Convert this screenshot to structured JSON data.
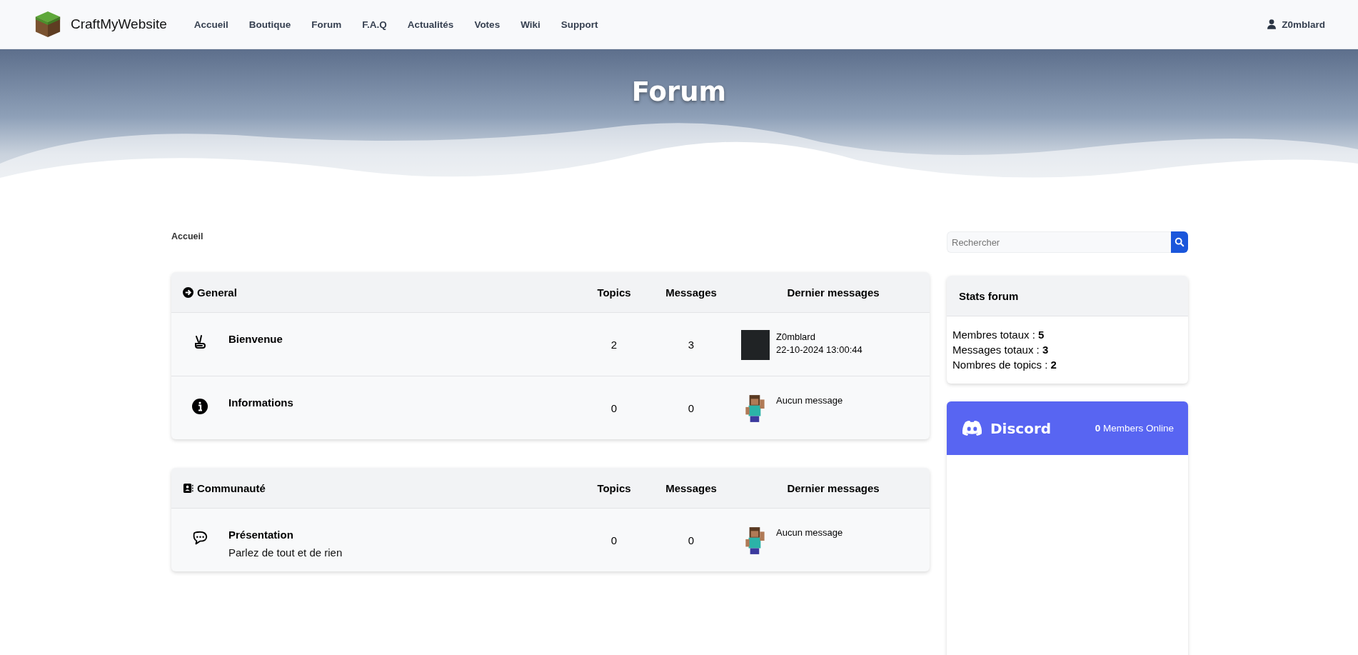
{
  "navbar": {
    "brand": "CraftMyWebsite",
    "links": [
      {
        "label": "Accueil"
      },
      {
        "label": "Boutique"
      },
      {
        "label": "Forum"
      },
      {
        "label": "F.A.Q"
      },
      {
        "label": "Actualités"
      },
      {
        "label": "Votes"
      },
      {
        "label": "Wiki"
      },
      {
        "label": "Support"
      }
    ],
    "user": "Z0mblard"
  },
  "hero": {
    "title": "Forum"
  },
  "breadcrumb": "Accueil",
  "categories": [
    {
      "name": "General",
      "kind": "arrow",
      "columns": [
        "Topics",
        "Messages",
        "Dernier messages"
      ],
      "forums": [
        {
          "name": "Bienvenue",
          "kind": "peace",
          "topics": "2",
          "messages": "3",
          "last": {
            "kind": "user",
            "author": "Z0mblard",
            "date": "22-10-2024 13:00:44"
          }
        },
        {
          "name": "Informations",
          "kind": "info",
          "topics": "0",
          "messages": "0",
          "last": {
            "kind": "none",
            "text": "Aucun message"
          }
        }
      ]
    },
    {
      "name": "Communauté",
      "kind": "contact",
      "columns": [
        "Topics",
        "Messages",
        "Dernier messages"
      ],
      "forums": [
        {
          "name": "Présentation",
          "description": "Parlez de tout et de rien",
          "kind": "chat",
          "topics": "0",
          "messages": "0",
          "last": {
            "kind": "none",
            "text": "Aucun message"
          }
        }
      ]
    }
  ],
  "search": {
    "placeholder": "Rechercher"
  },
  "stats": {
    "title": "Stats forum",
    "lines": [
      "Membres totaux : **5**",
      "Messages totaux : **3**",
      "Nombres de topics : **2**"
    ]
  },
  "discord": {
    "name": "Discord",
    "count": "0",
    "label": "Members Online"
  }
}
